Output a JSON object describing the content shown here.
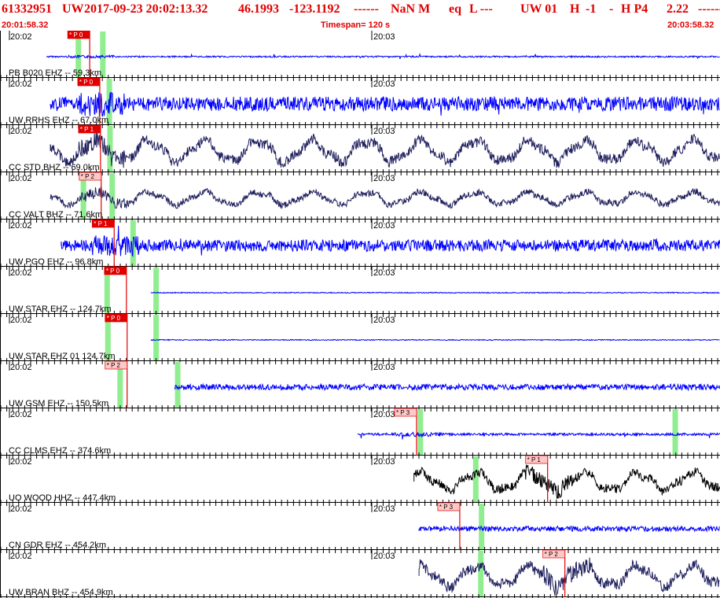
{
  "header": {
    "event_id": "61332951",
    "network": "UW",
    "origin_time": "2017-09-23 20:02:13.32",
    "lat": "46.1993",
    "lon": "-123.1192",
    "dashes1": "------",
    "mag": "NaN M",
    "etype": "eq",
    "local": "L ---",
    "auth": "UW 01",
    "h": "H",
    "depth_flag": "-1",
    "dash": "-",
    "hp": "H P4",
    "value": "2.22",
    "dashes2": "-------"
  },
  "subheader": {
    "start_time": "20:01:58.32",
    "timespan": "Timespan= 120 s",
    "end_time": "20:03:58.32"
  },
  "colors": {
    "header_text": "#e00000",
    "trace_blue": "#0000ff",
    "trace_navy": "#20205e",
    "trace_black": "#000000",
    "pick_red": "#e00000",
    "pick_pink": "#ffc8c8",
    "pick_line": "#e00000",
    "s_window": "#90ee90",
    "divider": "#000000"
  },
  "traces": [
    {
      "station": "PB B020 EHZ -- 59.3km",
      "t1": "20:02",
      "t2": "20:03",
      "color": "blue",
      "pick_label": "* P 0",
      "pick_style": "red",
      "start": 0.065,
      "pick": 0.094,
      "green": [
        0.105,
        0.139
      ],
      "style": "spiky",
      "amp": 0.18
    },
    {
      "station": "UW RRHS EHZ -- 67.0km",
      "t1": "20:02",
      "t2": "20:03",
      "color": "blue",
      "pick_label": "* P 0",
      "pick_style": "red",
      "start": 0.07,
      "pick": 0.108,
      "green": [
        0.148
      ],
      "style": "noisy",
      "amp": 0.55
    },
    {
      "station": "CC STD BHZ -- 69.0km",
      "t1": "20:02",
      "t2": "20:03",
      "color": "navy",
      "pick_label": "* P 1",
      "pick_style": "red",
      "start": 0.07,
      "pick": 0.109,
      "green": [
        0.149
      ],
      "style": "wavy",
      "amp": 0.75
    },
    {
      "station": "CC VALT BHZ -- 71.6km",
      "t1": "20:02",
      "t2": "20:03",
      "color": "navy",
      "pick_label": "* P 2",
      "pick_style": "pink",
      "start": 0.07,
      "pick": 0.11,
      "green": [
        0.112,
        0.152
      ],
      "style": "wavy_small",
      "amp": 0.45
    },
    {
      "station": "UW PGO EHZ -- 96.8km",
      "t1": "20:02",
      "t2": "20:03",
      "color": "blue",
      "pick_label": "* P 1",
      "pick_style": "red",
      "start": 0.085,
      "pick": 0.128,
      "green": [
        0.181
      ],
      "style": "noisy",
      "amp": 0.45
    },
    {
      "station": "UW STAR EHZ -- 124.7km",
      "t1": "20:02",
      "t2": "20:03",
      "color": "blue",
      "pick_label": "* P 0",
      "pick_style": "red",
      "start": 0.21,
      "pick": 0.145,
      "green": [
        0.145,
        0.213
      ],
      "style": "flat",
      "amp": 0.08
    },
    {
      "station": "UW STAR EHZ 01 124.7km",
      "t1": "20:02",
      "t2": "20:03",
      "color": "blue",
      "pick_label": "* P 0",
      "pick_style": "red",
      "start": 0.21,
      "pick": 0.146,
      "green": [
        0.146,
        0.213
      ],
      "style": "flat",
      "amp": 0.08
    },
    {
      "station": "UW GSM EHZ -- 150.5km",
      "t1": "20:02",
      "t2": "20:03",
      "color": "blue",
      "pick_label": "* P 2",
      "pick_style": "pink",
      "start": 0.243,
      "pick": 0.146,
      "green": [
        0.163,
        0.243
      ],
      "style": "band",
      "amp": 0.25
    },
    {
      "station": "CC CLMS EHZ -- 374.6km",
      "t1": "20:02",
      "t2": "20:03",
      "color": "blue",
      "pick_label": "* P 3",
      "pick_style": "pink",
      "start": 0.497,
      "pick": 0.548,
      "green": [
        0.58,
        0.934
      ],
      "style": "spiky",
      "amp": 0.3
    },
    {
      "station": "UO WOOD HHZ -- 447.4km",
      "t1": "20:02",
      "t2": "20:03",
      "color": "black",
      "pick_label": "* P 1",
      "pick_style": "pink",
      "start": 0.575,
      "pick": 0.73,
      "green": [
        0.657
      ],
      "style": "wavy",
      "amp": 0.65
    },
    {
      "station": "CN GDR EHZ -- 454.2km",
      "t1": "20:02",
      "t2": "20:03",
      "color": "blue",
      "pick_label": "* P 3",
      "pick_style": "pink",
      "start": 0.582,
      "pick": 0.608,
      "green": [
        0.665
      ],
      "style": "noisy_small",
      "amp": 0.18
    },
    {
      "station": "UW BRAN BHZ -- 454.9km",
      "t1": "20:02",
      "t2": "20:03",
      "color": "navy",
      "pick_label": "* P 2",
      "pick_style": "pink",
      "start": 0.582,
      "pick": 0.754,
      "green": [
        0.664
      ],
      "style": "wavy",
      "amp": 0.75
    }
  ]
}
